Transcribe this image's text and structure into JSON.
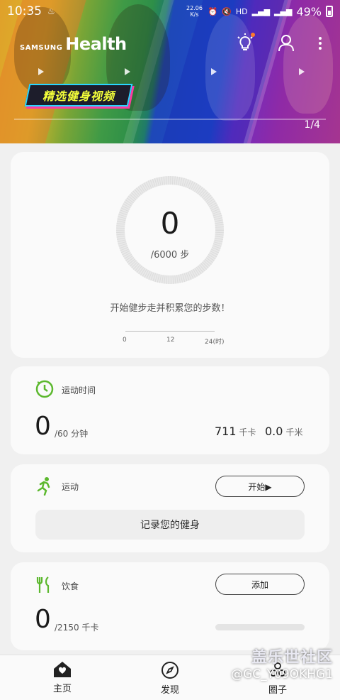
{
  "status_bar": {
    "time": "10:35",
    "net_speed": "22.06 K/s",
    "battery": "49%"
  },
  "banner": {
    "brand_small": "SAMSUNG",
    "brand_big": "Health",
    "promo_text": "精选健身视频",
    "pager": "1/4"
  },
  "steps_card": {
    "value": "0",
    "goal": "/6000 步",
    "hint": "开始健步走并积累您的步数！",
    "ticks": [
      "0",
      "12",
      "24(时)"
    ]
  },
  "active_card": {
    "title": "运动时间",
    "value": "0",
    "goal": "/60 分钟",
    "calories": "711",
    "calories_unit": "千卡",
    "distance": "0.0",
    "distance_unit": "千米"
  },
  "exercise_card": {
    "title": "运动",
    "start_label": "开始▶",
    "record_label": "记录您的健身"
  },
  "food_card": {
    "title": "饮食",
    "add_label": "添加",
    "value": "0",
    "goal": "/2150 千卡"
  },
  "bottom_nav": {
    "home": "主页",
    "discover": "发现",
    "together": "圈子"
  },
  "watermark": {
    "title": "盖乐世社区",
    "user": "@GC_Y09OKHG1"
  },
  "colors": {
    "accent_green": "#5cb82e",
    "text_dark": "#1a1a1a"
  }
}
